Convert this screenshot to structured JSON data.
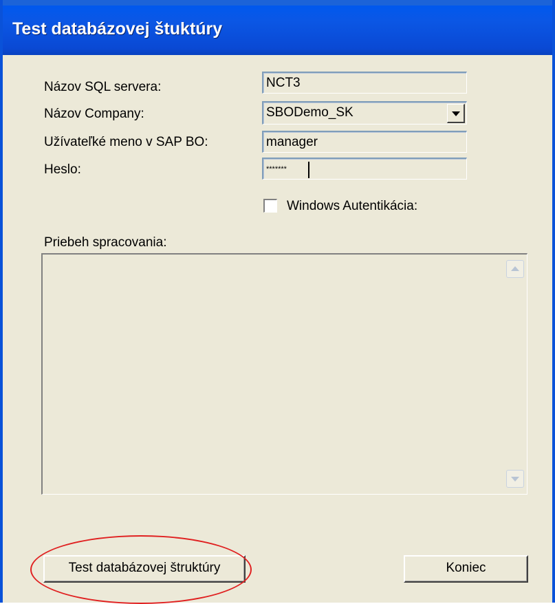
{
  "window": {
    "title": "Test databázovej štuktúry"
  },
  "form": {
    "sql_server_label": "Názov SQL servera:",
    "sql_server_value": "NCT3",
    "company_label": "Názov Company:",
    "company_value": "SBODemo_SK",
    "username_label": "Užívateľké meno v SAP BO:",
    "username_value": "manager",
    "password_label": "Heslo:",
    "password_value": "*******",
    "windows_auth_label": "Windows Autentikácia:",
    "windows_auth_checked": false
  },
  "progress": {
    "label": "Priebeh spracovania:",
    "log_text": ""
  },
  "buttons": {
    "test_label": "Test databázovej štruktúry",
    "close_label": "Koniec"
  },
  "colors": {
    "titlebar": "#0a5fe0",
    "dialog_background": "#ece9d8",
    "highlight_ellipse": "#e02020"
  },
  "icons": {
    "combo_dropdown": "chevron-down-icon",
    "scroll_up": "chevron-up-icon",
    "scroll_down": "chevron-down-icon"
  }
}
